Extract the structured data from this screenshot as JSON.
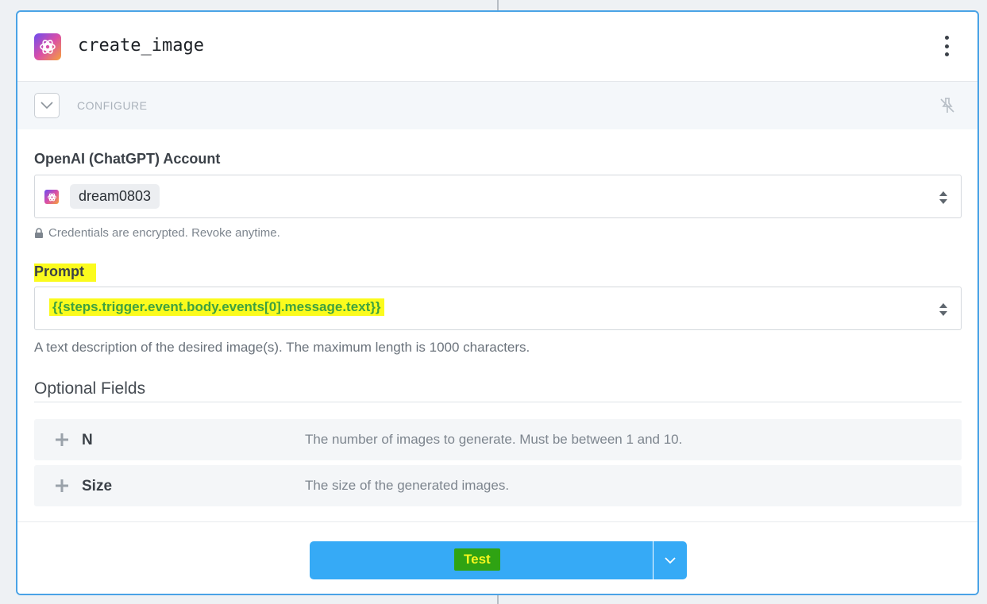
{
  "step": {
    "title": "create_image",
    "app_icon": "openai-logo-icon",
    "menu_icon": "kebab-menu-icon"
  },
  "configure": {
    "label": "CONFIGURE",
    "collapse_icon": "chevron-down-icon",
    "pin_icon": "pin-off-icon"
  },
  "account": {
    "label": "OpenAI (ChatGPT) Account",
    "value": "dream0803",
    "note": "Credentials are encrypted. Revoke anytime.",
    "note_icon": "lock-icon"
  },
  "prompt": {
    "label": "Prompt",
    "value": "{{steps.trigger.event.body.events[0].message.text}}",
    "description": "A text description of the desired image(s). The maximum length is 1000 characters."
  },
  "optional": {
    "title": "Optional Fields",
    "fields": [
      {
        "name": "N",
        "description": "The number of images to generate. Must be between 1 and 10."
      },
      {
        "name": "Size",
        "description": "The size of the generated images."
      }
    ]
  },
  "footer": {
    "test_label": "Test",
    "split_icon": "chevron-down-icon"
  },
  "colors": {
    "accent": "#36aaf6",
    "border": "#4aa3e6",
    "highlight": "#fbfb1d",
    "highlight_text": "#3fa23f"
  }
}
